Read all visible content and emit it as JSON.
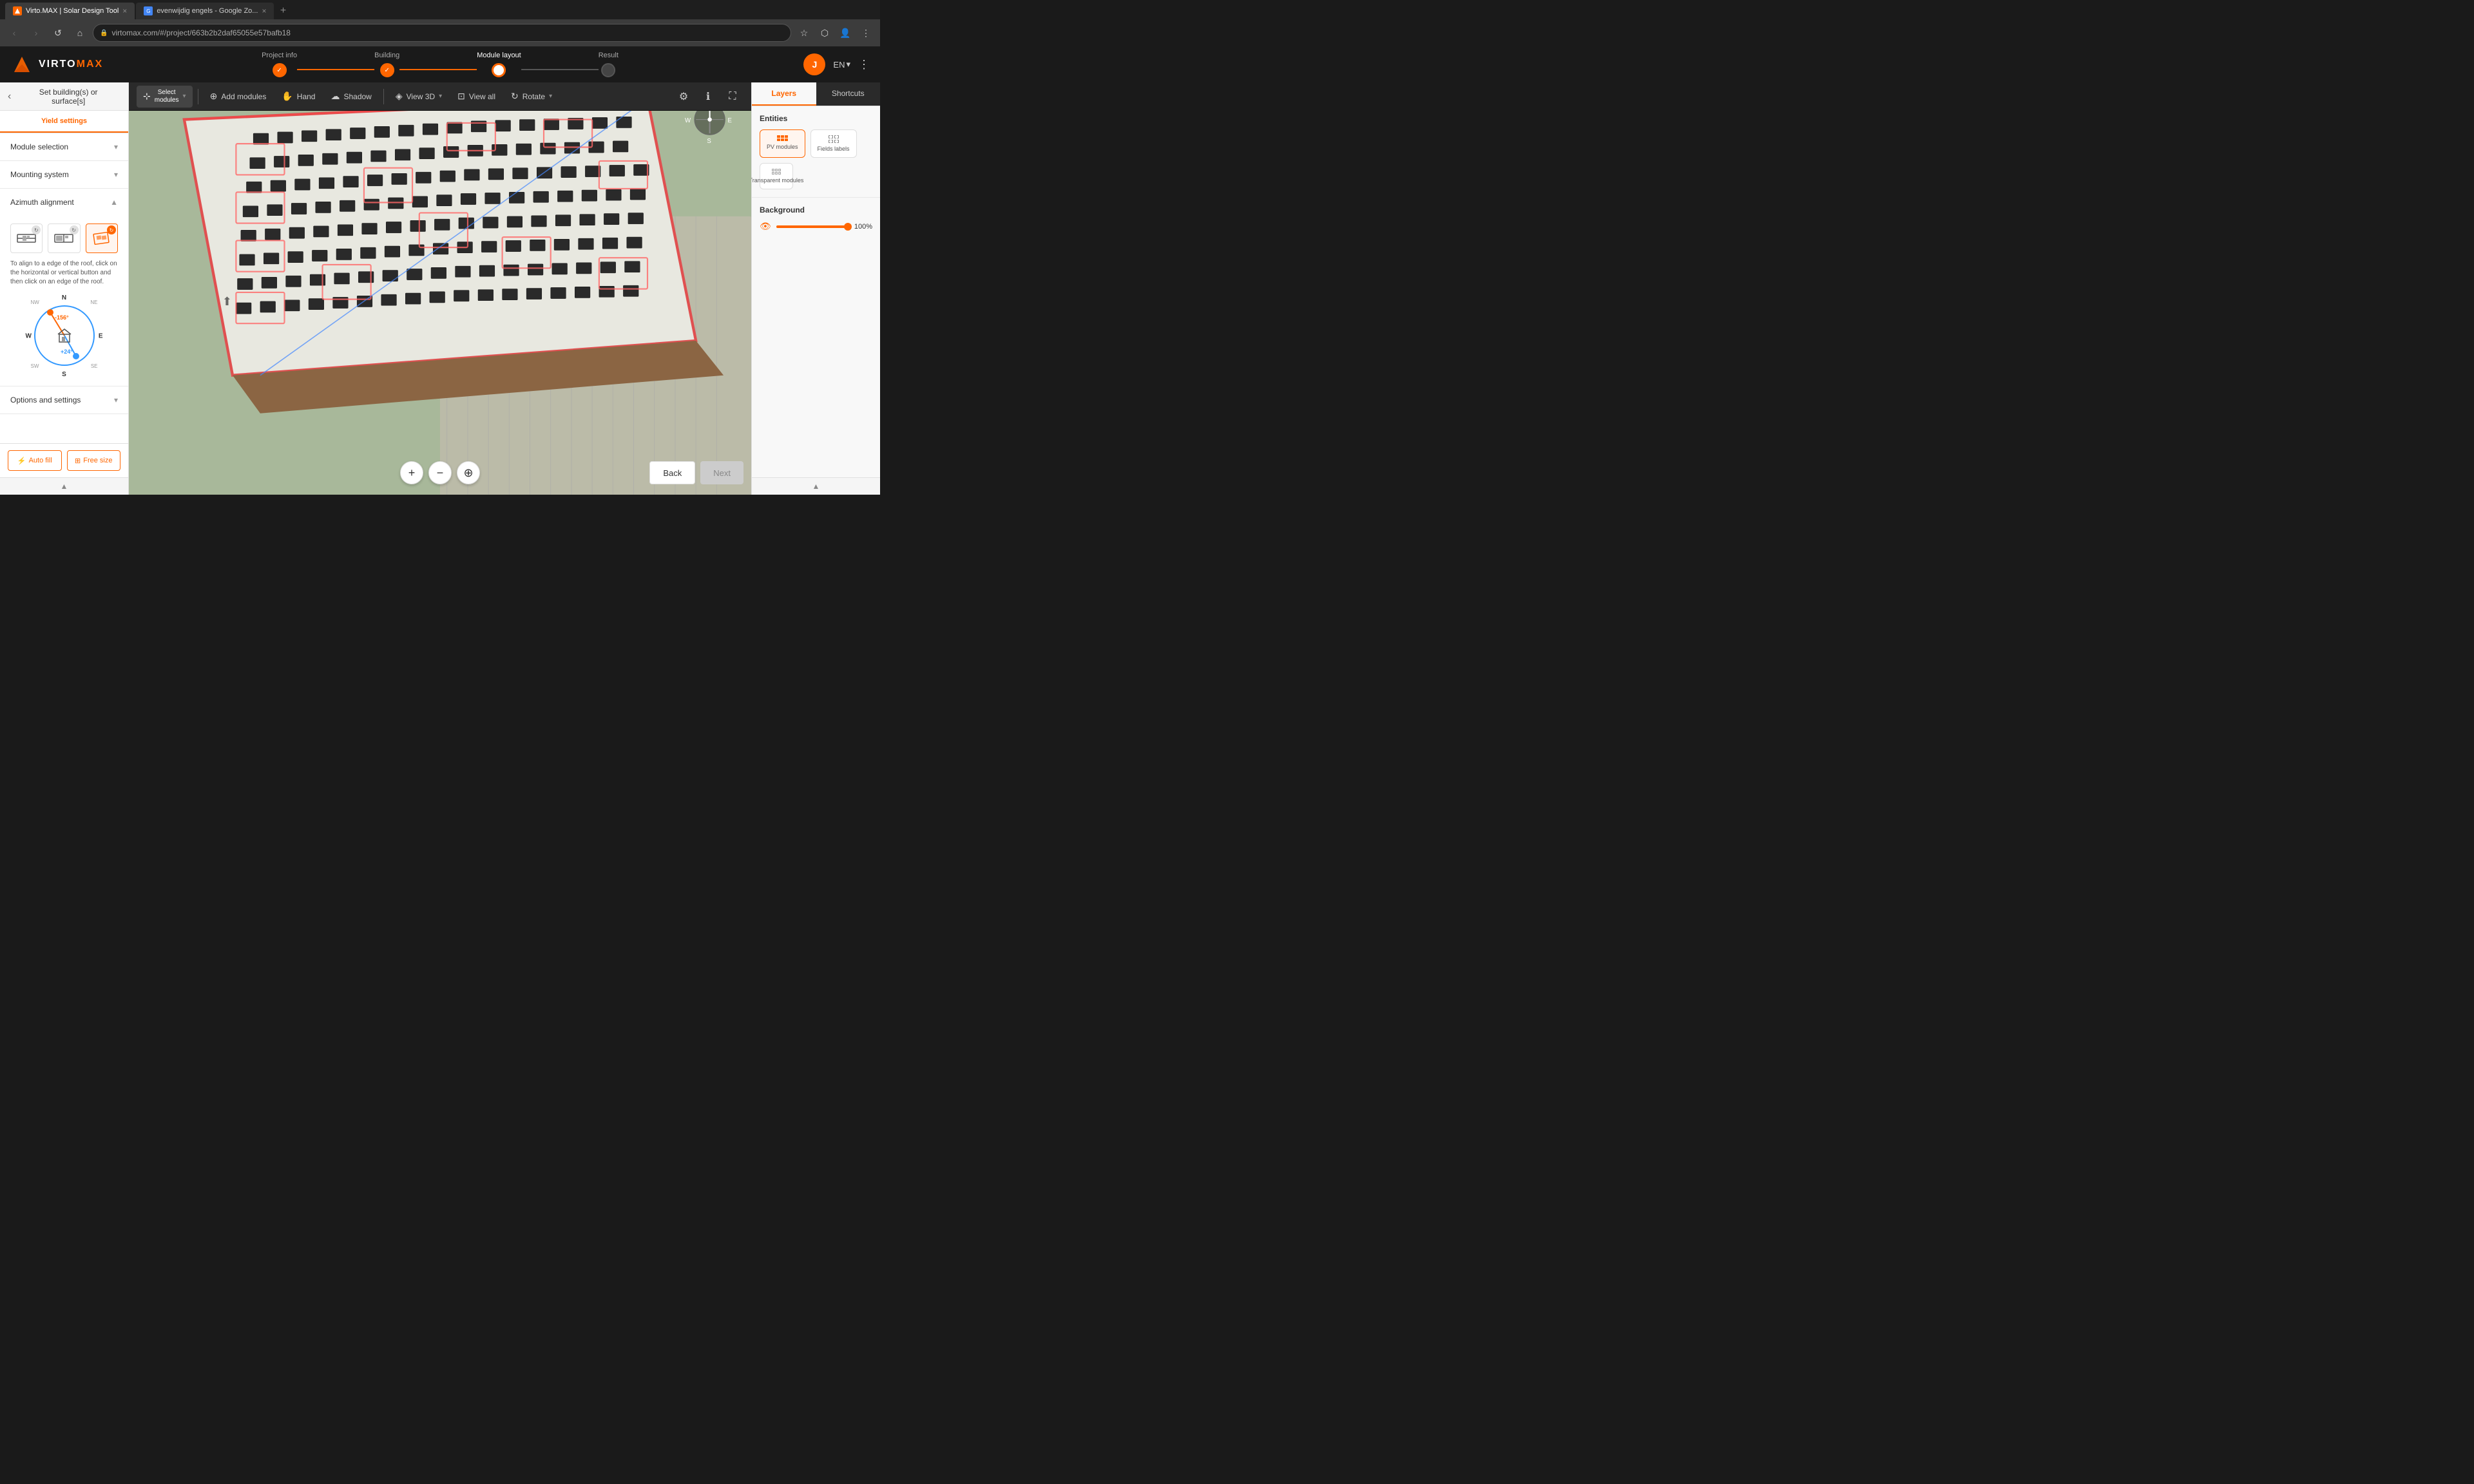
{
  "browser": {
    "tabs": [
      {
        "id": "tab1",
        "favicon": "V",
        "title": "Virto.MAX | Solar Design Tool",
        "active": true
      },
      {
        "id": "tab2",
        "favicon": "G",
        "title": "evenwijdig engels - Google Zo...",
        "active": false
      }
    ],
    "new_tab_label": "+",
    "nav": {
      "back_disabled": true,
      "forward_disabled": true,
      "refresh_label": "↺",
      "home_label": "⌂"
    },
    "address": "virtomax.com/#/project/663b2b2daf65055e57bafb18",
    "address_icon": "🔒"
  },
  "header": {
    "logo_text": "VIRTO",
    "logo_max": "MAX",
    "progress_steps": [
      {
        "label": "Project info",
        "state": "done"
      },
      {
        "label": "Building",
        "state": "done"
      },
      {
        "label": "Module layout",
        "state": "current"
      },
      {
        "label": "Result",
        "state": "todo"
      }
    ],
    "user_initial": "J",
    "lang": "EN",
    "menu_icon": "⋮"
  },
  "sidebar": {
    "back_label": "Set building(s) or\nsurface[s]",
    "tabs": [
      {
        "label": "Yield settings",
        "active": false
      }
    ],
    "sections": [
      {
        "id": "module-selection",
        "title": "Module selection",
        "expanded": false
      },
      {
        "id": "mounting-system",
        "title": "Mounting system",
        "expanded": false
      },
      {
        "id": "azimuth-alignment",
        "title": "Azimuth alignment",
        "expanded": true,
        "azimuth_buttons": [
          {
            "icon": "horizontal",
            "active": false
          },
          {
            "icon": "edge",
            "active": false
          },
          {
            "icon": "diagonal",
            "active": true
          }
        ],
        "hint": "To align to a edge of the roof, click on the horizontal or vertical button and then click on an edge of the roof.",
        "compass": {
          "angle_neg": "-156°",
          "angle_pos": "+24°"
        }
      },
      {
        "id": "options-settings",
        "title": "Options and settings",
        "expanded": false
      }
    ],
    "actions": [
      {
        "id": "auto-fill",
        "icon": "⚡",
        "label": "Auto fill"
      },
      {
        "id": "free-size",
        "icon": "⊞",
        "label": "Free size"
      }
    ]
  },
  "toolbar": {
    "select_label": "Select\nmodules",
    "add_modules_label": "Add modules",
    "hand_label": "Hand",
    "shadow_label": "Shadow",
    "view3d_label": "View 3D",
    "view_all_label": "View all",
    "rotate_label": "Rotate"
  },
  "right_panel": {
    "tabs": [
      {
        "label": "Layers",
        "active": true
      },
      {
        "label": "Shortcuts",
        "active": false
      }
    ],
    "entities_title": "Entities",
    "entities": [
      {
        "id": "pv-modules",
        "label": "PV modules",
        "active": true
      },
      {
        "id": "fields-labels",
        "label": "Fields labels",
        "active": false
      },
      {
        "id": "transparent-modules",
        "label": "Transparent\nmodules",
        "active": false
      }
    ],
    "background_title": "Background",
    "opacity_value": "100%",
    "opacity_pct": 100
  },
  "map_controls": {
    "zoom_in": "+",
    "zoom_out": "−",
    "locate": "⊕"
  },
  "bottom_nav": {
    "back_label": "Back",
    "next_label": "Next"
  }
}
